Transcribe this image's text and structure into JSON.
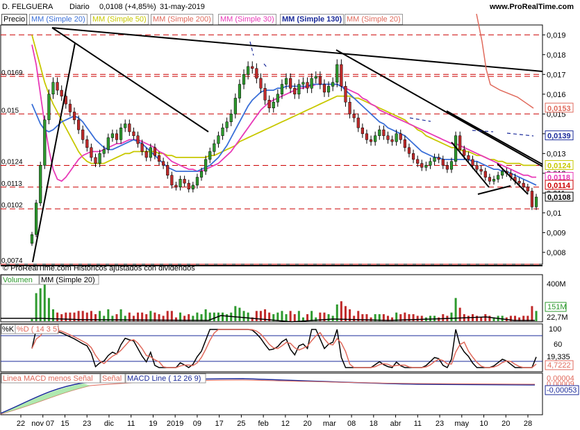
{
  "header": {
    "symbol": "D. FELGUERA",
    "period": "Diario",
    "last": "0,0108 (+4,85%)",
    "date": "31-may-2019",
    "site": "www.ProRealTime.com"
  },
  "legend": {
    "price_label": "Precio",
    "ma20": "MM (Simple 20)",
    "ma50": "MM (Simple 50)",
    "ma200": "MM (Simple 200)",
    "ma30": "MM (Simple 30)",
    "ma130": "MM (Simple 130)",
    "ma20b": "MM (Simple 20)",
    "credit": "© ProRealTime.com  Historicos ajustados con dividendos",
    "volume": "Volumen",
    "vol_ma": "MM (Simple 20)",
    "k": "%K",
    "d": "%D ( 14 3 5)",
    "macd_diff": "Linea MACD menos Señal",
    "macd_signal": "Señal",
    "macd_line": "MACD Line ( 12 26 9)"
  },
  "colors": {
    "ma20": "#3a6fd8",
    "ma50": "#c8c800",
    "ma200": "#e06a5c",
    "ma30": "#e83ab8",
    "ma130": "#1a2a9a",
    "up": "#2e9a2e",
    "down": "#c02a2a",
    "resistance": "#cc0000"
  },
  "chart_data": {
    "type": "candlestick",
    "x_ticks": [
      "22",
      "nov 07",
      "15",
      "23",
      "dic",
      "11",
      "19",
      "2019",
      "09",
      "17",
      "25",
      "feb",
      "12",
      "20",
      "mar",
      "08",
      "18",
      "abr",
      "11",
      "23",
      "may",
      "10",
      "20",
      "28"
    ],
    "price_axis": [
      "0,019",
      "0,018",
      "0,017",
      "0,016",
      "0,015",
      "0,014",
      "0,013",
      "0,012",
      "0,011",
      "0,01",
      "0,009",
      "0,008"
    ],
    "ylim": [
      0.0074,
      0.0195
    ],
    "left_labels": [
      "0,0169",
      "0,015",
      "0,0124",
      "0,0113",
      "0,0102",
      "0,0074"
    ],
    "right_tags": [
      {
        "value": "0,0153",
        "color": "#e06a5c"
      },
      {
        "value": "0,0139",
        "color": "#1a2a9a"
      },
      {
        "value": "0,0124",
        "color": "#c8c800"
      },
      {
        "value": "0,0118",
        "color": "#e83ab8"
      },
      {
        "value": "0,0114",
        "color": "#cc0000"
      },
      {
        "value": "0,0108",
        "color": "#000000"
      }
    ],
    "close": [
      0.0089,
      0.0105,
      0.0124,
      0.0147,
      0.016,
      0.0166,
      0.0162,
      0.0159,
      0.0155,
      0.0151,
      0.0147,
      0.0142,
      0.0137,
      0.0133,
      0.0128,
      0.0125,
      0.013,
      0.0132,
      0.0138,
      0.014,
      0.0137,
      0.0143,
      0.0145,
      0.0141,
      0.0139,
      0.0135,
      0.0131,
      0.0128,
      0.0133,
      0.0129,
      0.0126,
      0.0124,
      0.0119,
      0.0114,
      0.0113,
      0.0117,
      0.0115,
      0.0112,
      0.0114,
      0.0118,
      0.0121,
      0.0127,
      0.0131,
      0.0135,
      0.0139,
      0.0143,
      0.0146,
      0.015,
      0.0158,
      0.0165,
      0.017,
      0.0174,
      0.0173,
      0.0168,
      0.0163,
      0.0157,
      0.0153,
      0.0156,
      0.016,
      0.0165,
      0.0168,
      0.0163,
      0.016,
      0.0165,
      0.0166,
      0.0163,
      0.0168,
      0.0169,
      0.0165,
      0.0161,
      0.0164,
      0.0166,
      0.0175,
      0.0164,
      0.0156,
      0.015,
      0.0148,
      0.0143,
      0.014,
      0.0137,
      0.0136,
      0.0139,
      0.0142,
      0.0139,
      0.0137,
      0.0136,
      0.014,
      0.0137,
      0.0133,
      0.013,
      0.0127,
      0.0125,
      0.0123,
      0.0124,
      0.0126,
      0.0128,
      0.0127,
      0.0124,
      0.0122,
      0.0126,
      0.0139,
      0.0132,
      0.0129,
      0.0127,
      0.0124,
      0.0122,
      0.0121,
      0.0118,
      0.0116,
      0.0117,
      0.0119,
      0.0121,
      0.012,
      0.0118,
      0.0116,
      0.0115,
      0.0113,
      0.0111,
      0.0103,
      0.0108
    ],
    "ma20": [
      0.0155,
      0.015,
      0.0145,
      0.0142,
      0.0141,
      0.0142,
      0.0144,
      0.0146,
      0.0147,
      0.0148,
      0.0149,
      0.0148,
      0.0146,
      0.0143,
      0.014,
      0.0137,
      0.0135,
      0.0133,
      0.0132,
      0.0132,
      0.0133,
      0.0134,
      0.0135,
      0.0136,
      0.0137,
      0.0136,
      0.0135,
      0.0133,
      0.0131,
      0.0129,
      0.0127,
      0.0125,
      0.0123,
      0.0122,
      0.0121,
      0.0121,
      0.0121,
      0.0121,
      0.0121,
      0.0121,
      0.0122,
      0.0123,
      0.0124,
      0.0126,
      0.0128,
      0.0131,
      0.0134,
      0.0138,
      0.0142,
      0.0146,
      0.015,
      0.0154,
      0.0157,
      0.0159,
      0.0161,
      0.0162,
      0.0162,
      0.0162,
      0.0163,
      0.0163,
      0.0164,
      0.0164,
      0.0164,
      0.0164,
      0.0164,
      0.0164,
      0.0165,
      0.0165,
      0.0165,
      0.0165,
      0.0165,
      0.0165,
      0.0165,
      0.0164,
      0.0162,
      0.016,
      0.0158,
      0.0156,
      0.0154,
      0.0152,
      0.015,
      0.0148,
      0.0146,
      0.0145,
      0.0143,
      0.0142,
      0.0141,
      0.014,
      0.0139,
      0.0137,
      0.0135,
      0.0133,
      0.0131,
      0.013,
      0.0129,
      0.0128,
      0.0128,
      0.0127,
      0.0127,
      0.0127,
      0.0127,
      0.0127,
      0.0127,
      0.0127,
      0.0126,
      0.0126,
      0.0125,
      0.0124,
      0.0123,
      0.0122,
      0.0122,
      0.0121,
      0.0121,
      0.012,
      0.0119,
      0.0118,
      0.0117,
      0.0116,
      0.0115,
      0.0114
    ],
    "ma50": [
      0.019,
      0.0182,
      0.0174,
      0.0166,
      0.016,
      0.0155,
      0.0151,
      0.0147,
      0.0143,
      0.0139,
      0.0135,
      0.0131,
      0.0128,
      0.0126,
      0.0125,
      0.0125,
      0.0125,
      0.0125,
      0.0126,
      0.0127,
      0.0128,
      0.0129,
      0.013,
      0.013,
      0.0131,
      0.0131,
      0.0131,
      0.0131,
      0.0131,
      0.0131,
      0.013,
      0.013,
      0.0129,
      0.0129,
      0.0128,
      0.0128,
      0.0128,
      0.0128,
      0.0128,
      0.0128,
      0.0128,
      0.0128,
      0.0129,
      0.0129,
      0.013,
      0.0131,
      0.0132,
      0.0133,
      0.0134,
      0.0136,
      0.0137,
      0.0138,
      0.0139,
      0.014,
      0.0141,
      0.0142,
      0.0143,
      0.0144,
      0.0145,
      0.0146,
      0.0147,
      0.0148,
      0.0149,
      0.015,
      0.0151,
      0.0152,
      0.0153,
      0.0154,
      0.0155,
      0.0156,
      0.0157,
      0.0158,
      0.0159,
      0.0159,
      0.0159,
      0.0159,
      0.0158,
      0.0158,
      0.0157,
      0.0156,
      0.0155,
      0.0154,
      0.0153,
      0.0152,
      0.0151,
      0.015,
      0.0149,
      0.0148,
      0.0147,
      0.0145,
      0.0144,
      0.0142,
      0.0141,
      0.0139,
      0.0138,
      0.0137,
      0.0136,
      0.0135,
      0.0134,
      0.0133,
      0.0133,
      0.0132,
      0.0131,
      0.0131,
      0.013,
      0.0129,
      0.0129,
      0.0128,
      0.0127,
      0.0127,
      0.0126,
      0.0126,
      0.0125,
      0.0125,
      0.0125,
      0.0125,
      0.0124,
      0.0124,
      0.0124,
      0.0124
    ],
    "ma30": [
      0.0185,
      0.0175,
      0.016,
      0.0145,
      0.0132,
      0.0122,
      0.0117,
      0.0116,
      0.0118,
      0.0121,
      0.0124,
      0.0127,
      0.0129,
      0.013,
      0.0131,
      0.0131,
      0.0131,
      0.0132,
      0.0133,
      0.0134,
      0.0135,
      0.0135,
      0.0136,
      0.0137,
      0.0137,
      0.0137,
      0.0136,
      0.0135,
      0.0134,
      0.0133,
      0.0131,
      0.013,
      0.0128,
      0.0126,
      0.0125,
      0.0124,
      0.0123,
      0.0122,
      0.0122,
      0.0121,
      0.0121,
      0.0122,
      0.0123,
      0.0124,
      0.0125,
      0.0127,
      0.0129,
      0.0131,
      0.0134,
      0.0137,
      0.014,
      0.0143,
      0.0146,
      0.0149,
      0.0152,
      0.0154,
      0.0156,
      0.0157,
      0.0158,
      0.0159,
      0.016,
      0.0161,
      0.0162,
      0.0163,
      0.0163,
      0.0164,
      0.0164,
      0.0165,
      0.0165,
      0.0165,
      0.0165,
      0.0165,
      0.0165,
      0.0164,
      0.0163,
      0.0162,
      0.0161,
      0.016,
      0.0158,
      0.0157,
      0.0155,
      0.0154,
      0.0152,
      0.0151,
      0.015,
      0.0149,
      0.0148,
      0.0147,
      0.0146,
      0.0145,
      0.0144,
      0.0143,
      0.0142,
      0.0141,
      0.014,
      0.0139,
      0.0138,
      0.0137,
      0.0136,
      0.0135,
      0.0135,
      0.0134,
      0.0133,
      0.0132,
      0.0131,
      0.013,
      0.0129,
      0.0128,
      0.0127,
      0.0126,
      0.0125,
      0.0124,
      0.0123,
      0.0122,
      0.0121,
      0.012,
      0.0119,
      0.0119,
      0.0118,
      0.0118
    ],
    "stoch_axis": [
      "100",
      "60",
      "19,335"
    ],
    "stoch_tag": "4,7222",
    "volume_axis": [
      "400M"
    ],
    "volume_tags": [
      "151M",
      "22,7M"
    ],
    "macd_tags": [
      "0,00004",
      "0,00009",
      "-0,00053"
    ]
  }
}
